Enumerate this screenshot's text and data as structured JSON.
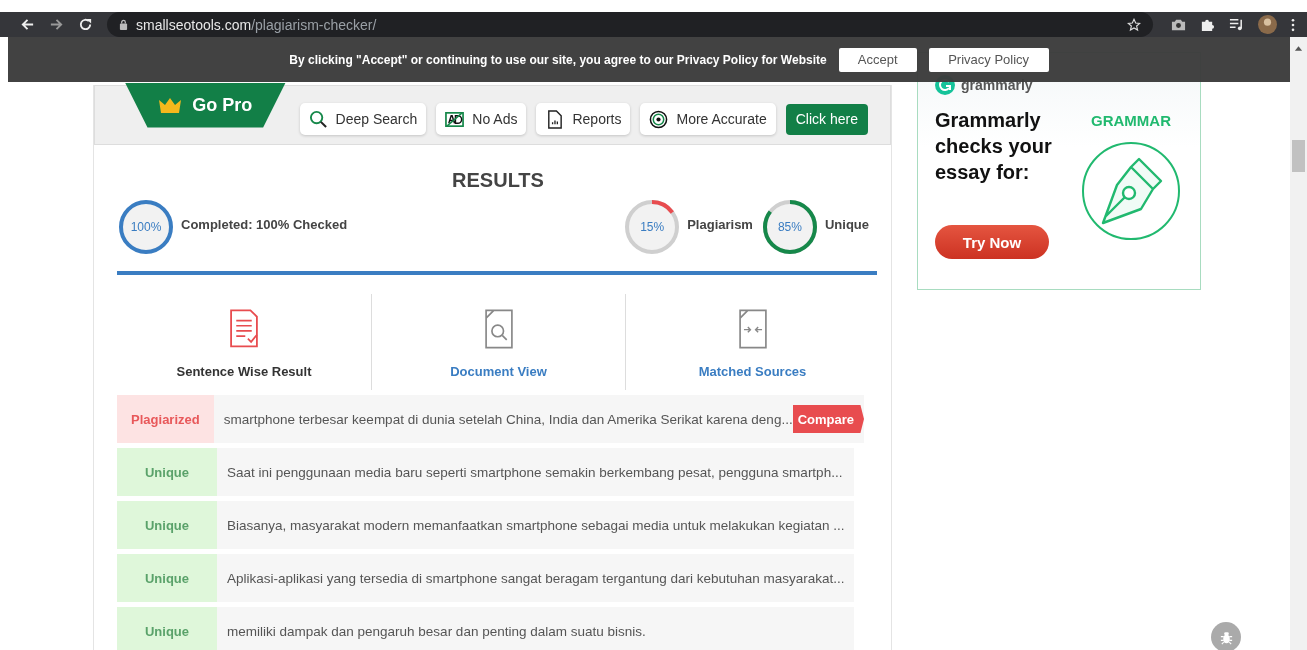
{
  "browser": {
    "url_domain": "smallseotools.com",
    "url_path": "/plagiarism-checker/"
  },
  "cookie_banner": {
    "message": "By clicking \"Accept\" or continuing to use our site, you agree to our Privacy Policy for Website",
    "buttons": [
      "Accept",
      "Privacy Policy"
    ]
  },
  "pro_bar": {
    "badge": "Go Pro",
    "features": [
      {
        "label": "Deep Search",
        "kind": "search"
      },
      {
        "label": "No Ads",
        "kind": "noads"
      },
      {
        "label": "Reports",
        "kind": "report"
      },
      {
        "label": "More Accurate",
        "kind": "target"
      }
    ],
    "cta": "Click here"
  },
  "results": {
    "title": "RESULTS",
    "meters": [
      {
        "reading": "100%",
        "label": "Completed: 100% Checked",
        "color": "#3a7dc2"
      },
      {
        "reading": "15%",
        "label": "Plagiarism",
        "color": "#e84c4f"
      },
      {
        "reading": "85%",
        "label": "Unique",
        "color": "#16884a"
      }
    ],
    "progress_bar": {
      "level": 1
    }
  },
  "views": [
    {
      "label": "Sentence Wise Result",
      "kind": "sentence",
      "selected": true
    },
    {
      "label": "Document View",
      "kind": "document",
      "selected": false
    },
    {
      "label": "Matched Sources",
      "kind": "sources",
      "selected": false
    }
  ],
  "rows": [
    {
      "status": "Plagiarized",
      "kind": "plagiarized",
      "text": "smartphone terbesar keempat di dunia setelah China, India dan Amerika Serikat karena deng...",
      "action": "Compare"
    },
    {
      "status": "Unique",
      "kind": "unique",
      "text": "Saat ini penggunaan media baru seperti smartphone semakin berkembang pesat, pengguna smartph..."
    },
    {
      "status": "Unique",
      "kind": "unique",
      "text": "Biasanya, masyarakat modern memanfaatkan smartphone sebagai media untuk melakukan kegiatan ..."
    },
    {
      "status": "Unique",
      "kind": "unique",
      "text": "Aplikasi-aplikasi yang tersedia di smartphone sangat beragam tergantung dari kebutuhan masyarakat..."
    },
    {
      "status": "Unique",
      "kind": "unique",
      "text": "memiliki dampak dan pengaruh besar dan penting dalam suatu bisnis."
    }
  ],
  "ad": {
    "logo": "grammarly",
    "headline": "Grammarly checks your essay for:",
    "tag": "GRAMMAR",
    "button": "Try Now"
  }
}
